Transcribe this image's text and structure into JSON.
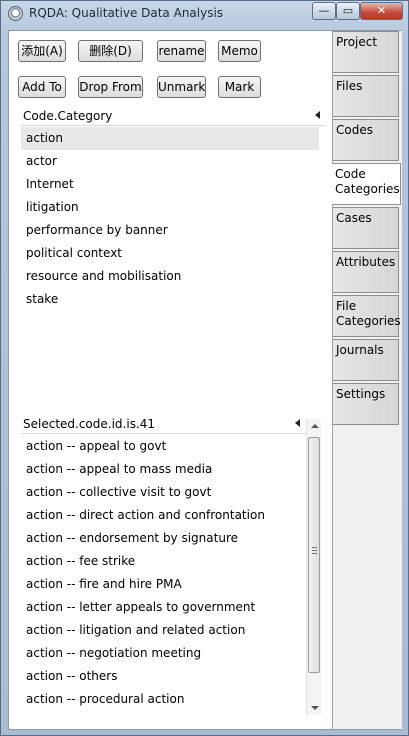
{
  "window": {
    "title": "RQDA: Qualitative Data Analysis",
    "min": "—",
    "max": "▭",
    "close": "✕"
  },
  "toolbar": {
    "add": "添加(A)",
    "delete": "删除(D)",
    "rename": "rename",
    "memo": "Memo",
    "add_to": "Add To",
    "drop_from": "Drop From",
    "unmark": "Unmark",
    "mark": "Mark"
  },
  "categories": {
    "header": "Code.Category",
    "items": [
      "action",
      "actor",
      "Internet",
      "litigation",
      "performance by banner",
      "political context",
      "resource and mobilisation",
      "stake"
    ]
  },
  "codes": {
    "header": "Selected.code.id.is.41",
    "items": [
      "action -- appeal to govt",
      "action -- appeal to mass media",
      "action -- collective visit to govt",
      "action -- direct action and confrontation",
      "action -- endorsement by signature",
      "action -- fee strike",
      "action -- fire and hire PMA",
      "action -- letter appeals to government",
      "action -- litigation and related action",
      "action -- negotiation meeting",
      "action -- others",
      "action -- procedural action"
    ]
  },
  "tabs": [
    "Project",
    "Files",
    "Codes",
    "Code Categories",
    "Cases",
    "Attributes",
    "File Categories",
    "Journals",
    "Settings"
  ],
  "active_tab": "Code Categories"
}
